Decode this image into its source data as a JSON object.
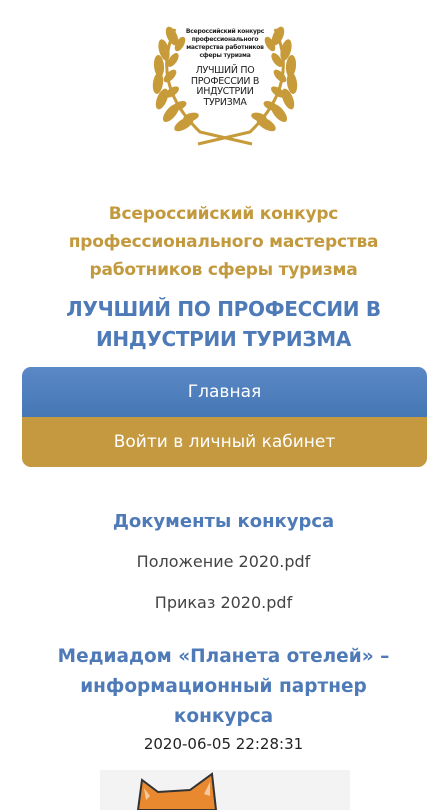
{
  "logo": {
    "small_text": "Всероссийский конкурс профессионального мастерства работников сферы туризма",
    "big_text": "ЛУЧШИЙ ПО ПРОФЕССИИ В ИНДУСТРИИ ТУРИЗМА"
  },
  "header": {
    "subtitle_line1": "Всероссийский конкурс",
    "subtitle_line2": "профессионального мастерства",
    "subtitle_line3": "работников сферы туризма",
    "title_line1": "ЛУЧШИЙ ПО ПРОФЕССИИ В",
    "title_line2": "ИНДУСТРИИ ТУРИЗМА"
  },
  "nav": {
    "home_label": "Главная",
    "cabinet_label": "Войти в личный кабинет"
  },
  "documents": {
    "heading": "Документы конкурса",
    "items": [
      {
        "label": "Положение 2020.pdf"
      },
      {
        "label": "Приказ 2020.pdf"
      }
    ]
  },
  "news": {
    "heading_line1": "Медиадом «Планета отелей» –",
    "heading_line2": "информационный партнер",
    "heading_line3": "конкурса",
    "date": "2020-06-05 22:28:31"
  },
  "colors": {
    "gold": "#c4993f",
    "blue": "#4e7ab7"
  },
  "icons": {
    "logo": "laurel-wreath-icon",
    "news_image": "cat-mascot-icon"
  }
}
